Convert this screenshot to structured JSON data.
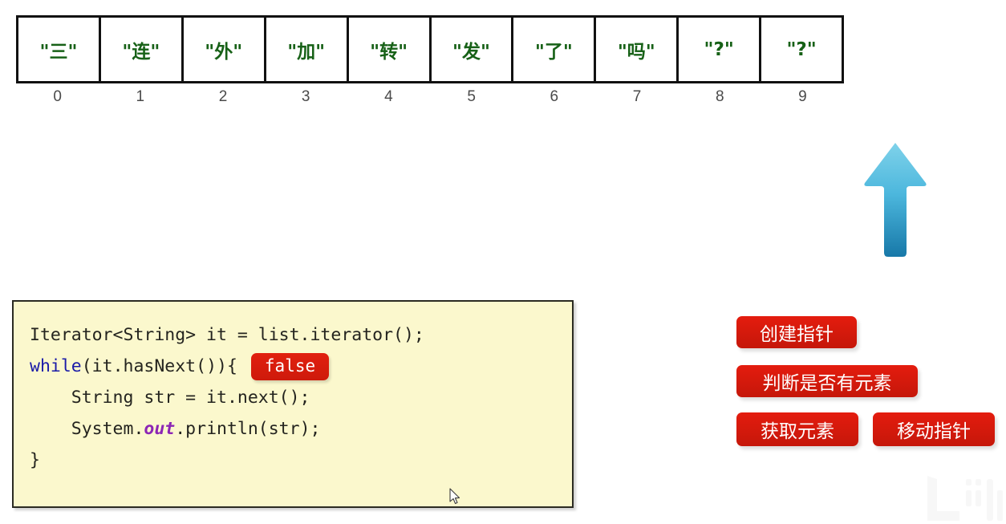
{
  "array": {
    "cells": [
      {
        "value": "\"三\"",
        "index": "0"
      },
      {
        "value": "\"连\"",
        "index": "1"
      },
      {
        "value": "\"外\"",
        "index": "2"
      },
      {
        "value": "\"加\"",
        "index": "3"
      },
      {
        "value": "\"转\"",
        "index": "4"
      },
      {
        "value": "\"发\"",
        "index": "5"
      },
      {
        "value": "\"了\"",
        "index": "6"
      },
      {
        "value": "\"吗\"",
        "index": "7"
      },
      {
        "value": "\"?\"",
        "index": "8"
      },
      {
        "value": "\"?\"",
        "index": "9"
      }
    ],
    "value_color": "#176117",
    "border_color": "#111111",
    "index_color": "#4a4a4a"
  },
  "pointer": {
    "icon": "arrow-up-icon",
    "color_top": "#6ecbe6",
    "color_bottom": "#1a86b5"
  },
  "code": {
    "background": "#fbf8cd",
    "border_color": "#2b2b22",
    "line1_part1": "Iterator<String> it = list.iterator();",
    "line2_keyword": "while",
    "line2_rest": "(it.hasNext()){",
    "false_badge": "false",
    "false_badge_color": "#d81e0b",
    "line3": "    String str = it.next();",
    "line4_part1": "    System.",
    "line4_keyword": "out",
    "line4_part2": ".println(str);",
    "line5": "}"
  },
  "steps": {
    "create_pointer": "创建指针",
    "has_element": "判断是否有元素",
    "get_element": "获取元素",
    "move_pointer": "移动指针",
    "badge_color": "#d81b0d"
  },
  "watermark": {
    "label": "bilibili"
  }
}
